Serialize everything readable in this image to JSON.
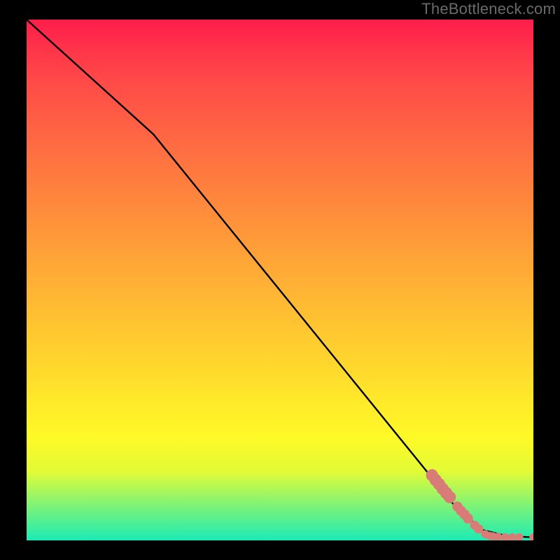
{
  "attribution": "TheBottleneck.com",
  "chart_data": {
    "type": "line",
    "title": "",
    "xlabel": "",
    "ylabel": "",
    "xlim": [
      0,
      100
    ],
    "ylim": [
      0,
      100
    ],
    "series": [
      {
        "name": "curve",
        "style": "line",
        "color": "#000000",
        "points": [
          {
            "x": 0,
            "y": 100
          },
          {
            "x": 25,
            "y": 78
          },
          {
            "x": 85,
            "y": 6
          },
          {
            "x": 90,
            "y": 2
          },
          {
            "x": 95,
            "y": 0.8
          },
          {
            "x": 100,
            "y": 0.6
          }
        ]
      },
      {
        "name": "markers",
        "style": "scatter",
        "color": "#d97b76",
        "points": [
          {
            "x": 80.0,
            "y": 12.5,
            "r": 1.2
          },
          {
            "x": 80.7,
            "y": 11.6,
            "r": 1.2
          },
          {
            "x": 81.4,
            "y": 10.8,
            "r": 1.2
          },
          {
            "x": 82.1,
            "y": 9.9,
            "r": 1.2
          },
          {
            "x": 82.8,
            "y": 9.1,
            "r": 1.2
          },
          {
            "x": 83.5,
            "y": 8.3,
            "r": 1.2
          },
          {
            "x": 85.0,
            "y": 6.5,
            "r": 1.0
          },
          {
            "x": 85.7,
            "y": 5.7,
            "r": 1.0
          },
          {
            "x": 86.4,
            "y": 5.0,
            "r": 1.0
          },
          {
            "x": 87.1,
            "y": 4.2,
            "r": 1.0
          },
          {
            "x": 88.4,
            "y": 2.9,
            "r": 0.9
          },
          {
            "x": 89.2,
            "y": 2.2,
            "r": 0.9
          },
          {
            "x": 90.5,
            "y": 1.2,
            "r": 0.8
          },
          {
            "x": 91.3,
            "y": 0.9,
            "r": 0.8
          },
          {
            "x": 92.0,
            "y": 0.8,
            "r": 0.8
          },
          {
            "x": 93.0,
            "y": 0.7,
            "r": 0.8
          },
          {
            "x": 94.4,
            "y": 0.6,
            "r": 0.8
          },
          {
            "x": 95.8,
            "y": 0.6,
            "r": 0.8
          },
          {
            "x": 97.2,
            "y": 0.6,
            "r": 0.8
          },
          {
            "x": 100.0,
            "y": 0.6,
            "r": 0.8
          }
        ]
      }
    ]
  }
}
